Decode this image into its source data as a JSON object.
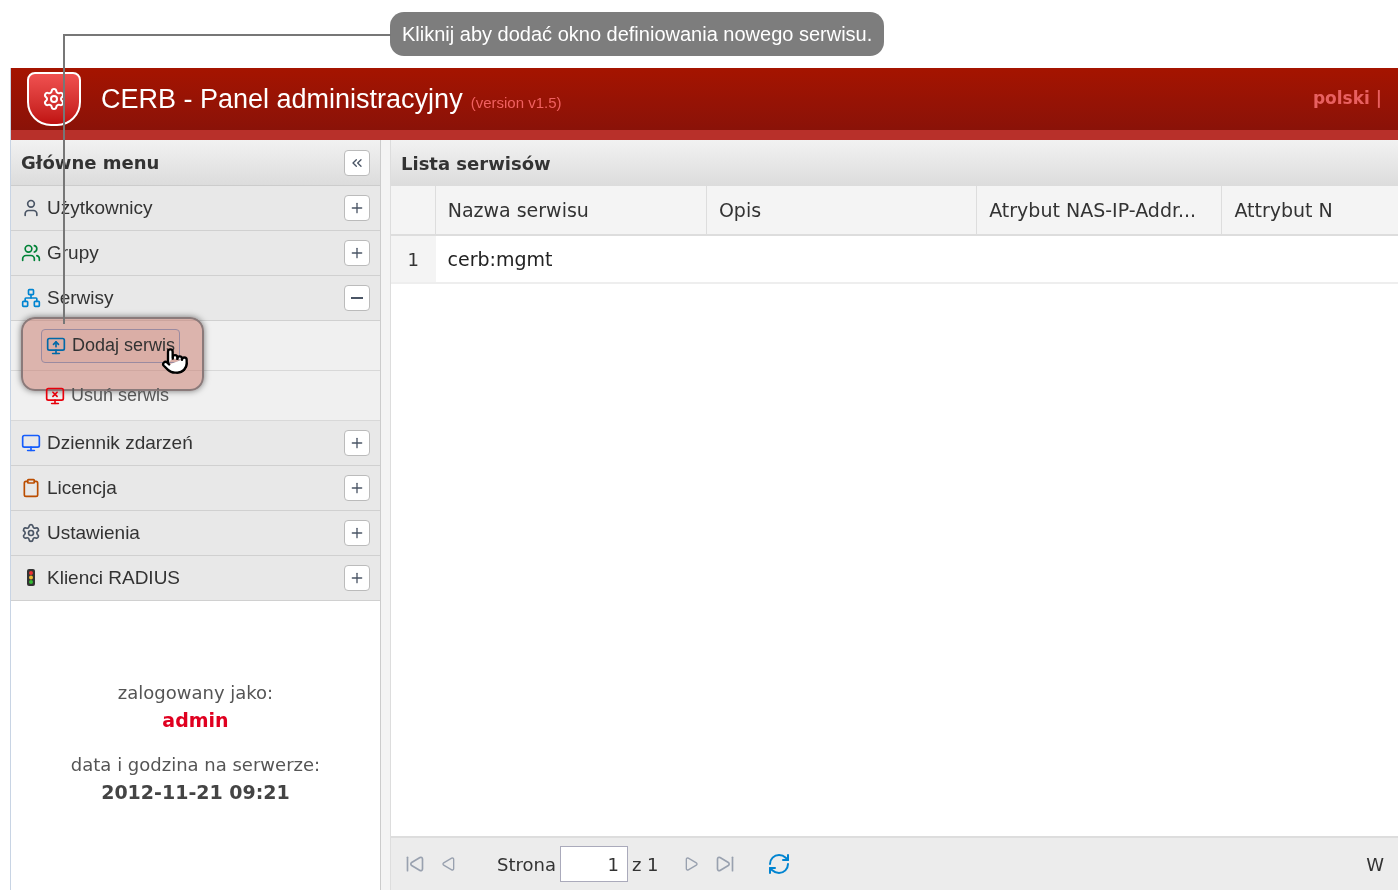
{
  "callout": {
    "text": "Kliknij aby dodać okno definiowania nowego serwisu."
  },
  "header": {
    "title": "CERB - Panel administracyjny",
    "version": "(version v1.5)",
    "language_links": "polski |"
  },
  "sidebar": {
    "title": "Główne menu",
    "items": [
      {
        "label": "Użytkownicy",
        "expanded": false
      },
      {
        "label": "Grupy",
        "expanded": false
      },
      {
        "label": "Serwisy",
        "expanded": true,
        "children": [
          {
            "label": "Dodaj serwis",
            "selected": true
          },
          {
            "label": "Usuń serwis",
            "selected": false
          }
        ]
      },
      {
        "label": "Dziennik zdarzeń",
        "expanded": false
      },
      {
        "label": "Licencja",
        "expanded": false
      },
      {
        "label": "Ustawienia",
        "expanded": false
      },
      {
        "label": "Klienci RADIUS",
        "expanded": false
      }
    ],
    "login_label": "zalogowany jako:",
    "user": "admin",
    "time_label": "data i godzina na serwerze:",
    "time": "2012-11-21 09:21"
  },
  "table": {
    "title": "Lista serwisów",
    "columns": [
      "Nazwa serwisu",
      "Opis",
      "Atrybut NAS-IP-Addr...",
      "Attrybut N"
    ],
    "rows": [
      {
        "number": "1",
        "cells": [
          "cerb:mgmt",
          "",
          "",
          ""
        ]
      }
    ]
  },
  "pager": {
    "page_label": "Strona",
    "page": "1",
    "of": "z 1",
    "right_text": "W"
  }
}
